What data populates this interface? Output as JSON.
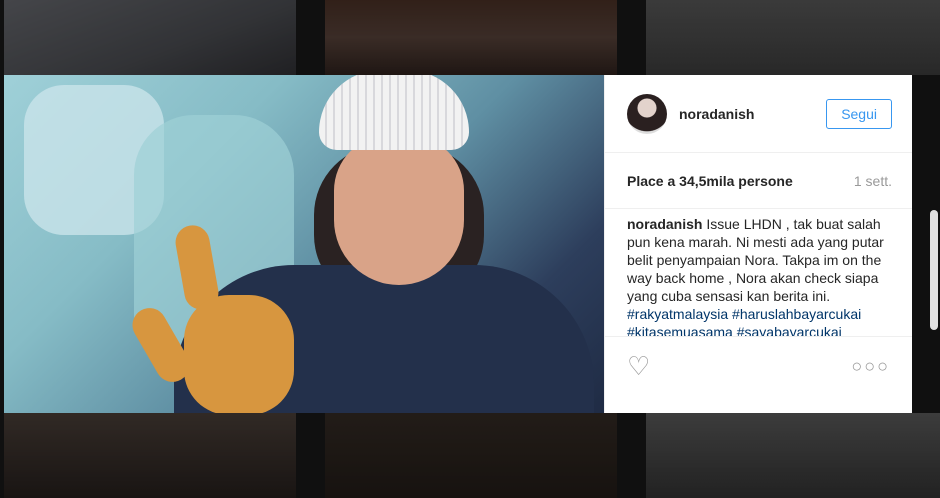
{
  "post": {
    "username": "noradanish",
    "follow_label": "Segui",
    "likes_text": "Place a 34,5mila persone",
    "time_text": "1 sett.",
    "caption_user": "noradanish",
    "caption_text": "Issue LHDN , tak buat salah pun kena marah. Ni mesti ada yang putar belit penyampaian Nora. Takpa im on the way back home , Nora akan check siapa yang cuba sensasi kan berita ini.",
    "hashtags": "#rakyatmalaysia #haruslahbayarcukai #kitasemuasama #sayabayarcukai #kesiankenamarah #takpasalpasal"
  },
  "icons": {
    "like": "heart-icon",
    "more": "more-options-icon"
  }
}
